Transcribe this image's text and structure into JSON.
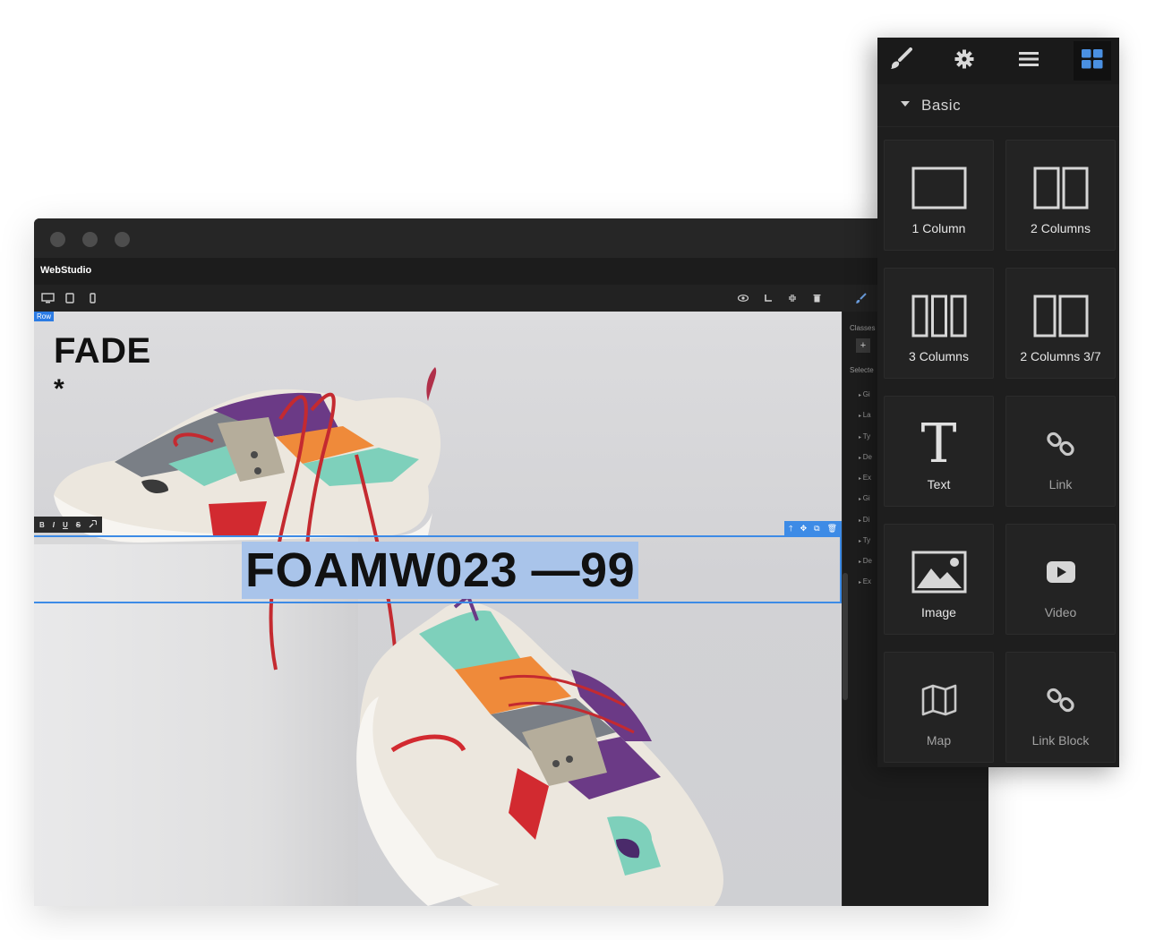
{
  "app": {
    "brand": "WebStudio"
  },
  "canvas": {
    "row_badge": "Row",
    "heading": "FADE",
    "asterisk": "*",
    "product_title": "FOAMW023 —99"
  },
  "rte_toolbar": [
    "B",
    "I",
    "U",
    "S",
    "🔧"
  ],
  "style_manager": {
    "classes_label": "Classes",
    "add_label": "+",
    "selected_label": "Selecte",
    "properties": [
      "Gi",
      "La",
      "Ty",
      "De",
      "Ex",
      "Gi",
      "Di",
      "Ty",
      "De",
      "Ex"
    ]
  },
  "block_panel": {
    "section_label": "Basic",
    "blocks": [
      {
        "label": "1 Column",
        "icon": "one-column-icon",
        "bright": true
      },
      {
        "label": "2 Columns",
        "icon": "two-columns-icon",
        "bright": true
      },
      {
        "label": "3 Columns",
        "icon": "three-columns-icon",
        "bright": true
      },
      {
        "label": "2 Columns 3/7",
        "icon": "two-columns-37-icon",
        "bright": true
      },
      {
        "label": "Text",
        "icon": "text-icon",
        "bright": true
      },
      {
        "label": "Link",
        "icon": "link-icon",
        "bright": false
      },
      {
        "label": "Image",
        "icon": "image-icon",
        "bright": true
      },
      {
        "label": "Video",
        "icon": "video-icon",
        "bright": false
      },
      {
        "label": "Map",
        "icon": "map-icon",
        "bright": false
      },
      {
        "label": "Link Block",
        "icon": "link-block-icon",
        "bright": false
      }
    ]
  },
  "colors": {
    "accent": "#3d8be6",
    "selection": "#a9c4ea",
    "panel_bg": "#1e1e1e",
    "active_tab_icon": "#4a90e2"
  }
}
